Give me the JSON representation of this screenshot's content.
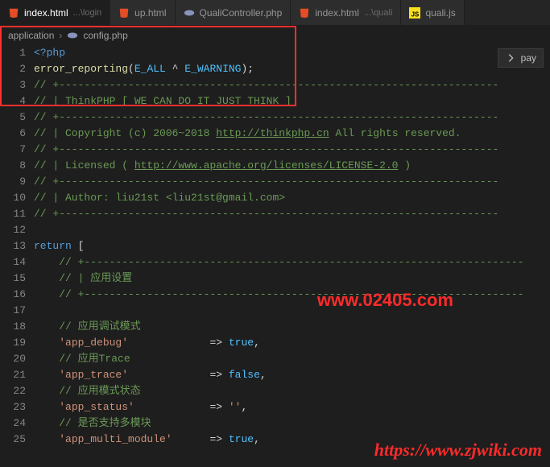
{
  "tabs": [
    {
      "name": "index.html",
      "hint": "...\\login",
      "icon": "html"
    },
    {
      "name": "up.html",
      "hint": "",
      "icon": "html"
    },
    {
      "name": "QualiController.php",
      "hint": "",
      "icon": "php"
    },
    {
      "name": "index.html",
      "hint": "...\\quali",
      "icon": "html"
    },
    {
      "name": "quali.js",
      "hint": "",
      "icon": "js"
    }
  ],
  "breadcrumb": {
    "seg1": "application",
    "seg2": "config.php"
  },
  "overflow": {
    "label": "pay"
  },
  "lines": [
    {
      "n": "1",
      "t": "phpopen"
    },
    {
      "n": "2",
      "t": "err"
    },
    {
      "n": "3",
      "t": "cmt",
      "txt": "// +----------------------------------------------------------------------"
    },
    {
      "n": "4",
      "t": "cmt",
      "txt": "// | ThinkPHP [ WE CAN DO IT JUST THINK ]"
    },
    {
      "n": "5",
      "t": "cmt",
      "txt": "// +----------------------------------------------------------------------"
    },
    {
      "n": "6",
      "t": "copy"
    },
    {
      "n": "7",
      "t": "cmt",
      "txt": "// +----------------------------------------------------------------------"
    },
    {
      "n": "8",
      "t": "lic"
    },
    {
      "n": "9",
      "t": "cmt",
      "txt": "// +----------------------------------------------------------------------"
    },
    {
      "n": "10",
      "t": "cmt",
      "txt": "// | Author: liu21st <liu21st@gmail.com>"
    },
    {
      "n": "11",
      "t": "cmt",
      "txt": "// +----------------------------------------------------------------------"
    },
    {
      "n": "12",
      "t": "blank"
    },
    {
      "n": "13",
      "t": "return"
    },
    {
      "n": "14",
      "t": "cmtind",
      "txt": "// +----------------------------------------------------------------------"
    },
    {
      "n": "15",
      "t": "cmtind",
      "txt": "// | 应用设置"
    },
    {
      "n": "16",
      "t": "cmtind",
      "txt": "// +----------------------------------------------------------------------"
    },
    {
      "n": "17",
      "t": "blank"
    },
    {
      "n": "18",
      "t": "cmtind",
      "txt": "// 应用调试模式"
    },
    {
      "n": "19",
      "t": "kv",
      "key": "app_debug",
      "val": "true",
      "comma": ","
    },
    {
      "n": "20",
      "t": "cmtind",
      "txt": "// 应用Trace"
    },
    {
      "n": "21",
      "t": "kv",
      "key": "app_trace",
      "val": "false",
      "comma": ","
    },
    {
      "n": "22",
      "t": "cmtind",
      "txt": "// 应用模式状态"
    },
    {
      "n": "23",
      "t": "kvs",
      "key": "app_status",
      "val": "''",
      "comma": ","
    },
    {
      "n": "24",
      "t": "cmtind",
      "txt": "// 是否支持多模块"
    },
    {
      "n": "25",
      "t": "kv",
      "key": "app_multi_module",
      "val": "true",
      "comma": ","
    }
  ],
  "tokens": {
    "phpopen": "<?php",
    "err_fn": "error_reporting",
    "err_args_open": "(",
    "err_c1": "E_ALL",
    "err_op": " ^ ",
    "err_c2": "E_WARNING",
    "err_close": ");",
    "copy_pre": "// | Copyright (c) 2006~2018 ",
    "copy_link": "http://thinkphp.cn",
    "copy_post": " All rights reserved.",
    "lic_pre": "// | Licensed ( ",
    "lic_link": "http://www.apache.org/licenses/LICENSE-2.0",
    "lic_post": " )",
    "return": "return",
    "bracket": " ["
  },
  "watermarks": {
    "w1": "www.02405.com",
    "w2": "https://www.zjwiki.com"
  }
}
